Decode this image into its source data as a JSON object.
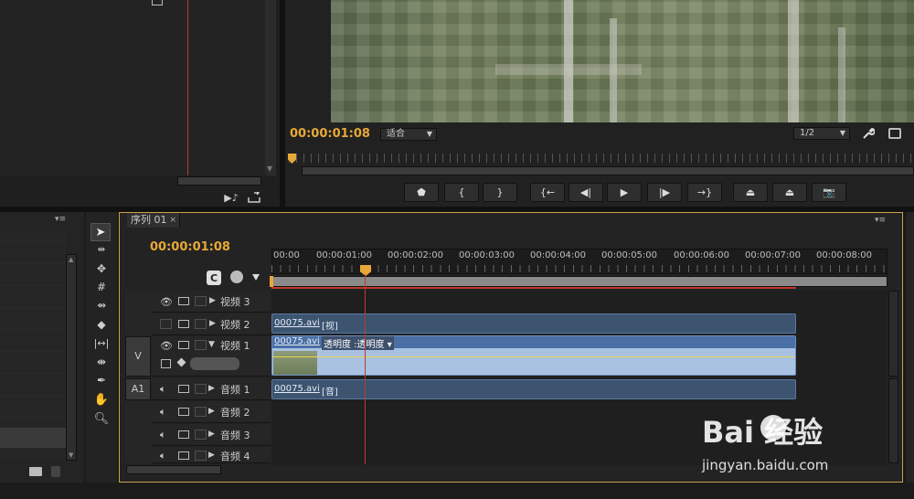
{
  "source_monitor": {
    "panel_icon": "export-frame-icon"
  },
  "program_monitor": {
    "timecode": "00:00:01:08",
    "fit_select": "适合",
    "resolution_select": "1/2",
    "transport_buttons": [
      {
        "name": "add-marker-button",
        "glyph": "⬟"
      },
      {
        "name": "mark-in-button",
        "glyph": "{"
      },
      {
        "name": "mark-out-button",
        "glyph": "}"
      },
      {
        "name": "go-to-in-button",
        "glyph": "{←"
      },
      {
        "name": "step-back-button",
        "glyph": "◀|"
      },
      {
        "name": "play-button",
        "glyph": "▶"
      },
      {
        "name": "step-forward-button",
        "glyph": "|▶"
      },
      {
        "name": "go-to-out-button",
        "glyph": "→}"
      },
      {
        "name": "lift-button",
        "glyph": "⏏"
      },
      {
        "name": "extract-button",
        "glyph": "⏏"
      },
      {
        "name": "export-frame-button",
        "glyph": "📷"
      }
    ]
  },
  "sequence": {
    "tab_label": "序列 01",
    "timecode": "00:00:01:08",
    "ruler_labels": [
      "00:00",
      "00:00:01:00",
      "00:00:02:00",
      "00:00:03:00",
      "00:00:04:00",
      "00:00:05:00",
      "00:00:06:00",
      "00:00:07:00",
      "00:00:08:00"
    ]
  },
  "tracks": {
    "video3": {
      "label": "视频 3"
    },
    "video2": {
      "label": "视频 2"
    },
    "video1": {
      "label": "视频 1",
      "patch": "V"
    },
    "audio1": {
      "label": "音频 1",
      "patch": "A1"
    },
    "audio2": {
      "label": "音频 2"
    },
    "audio3": {
      "label": "音频 3"
    },
    "audio4": {
      "label": "音频 4"
    }
  },
  "clips": {
    "v2": {
      "name": "00075.avi",
      "tag": "[视]"
    },
    "v1": {
      "name": "00075.avi",
      "effect": "透明度 :透明度 ▾"
    },
    "a1": {
      "name": "00075.avi",
      "tag": "[音]"
    }
  },
  "watermark": {
    "logo_text": "Bai 经验",
    "url": "jingyan.baidu.com"
  },
  "colors": {
    "timecode": "#e8a838",
    "playhead": "#c0392b",
    "clip_video": "#3c5470",
    "clip_selected": "#a9c2e2",
    "work_area": "#c0392b"
  }
}
